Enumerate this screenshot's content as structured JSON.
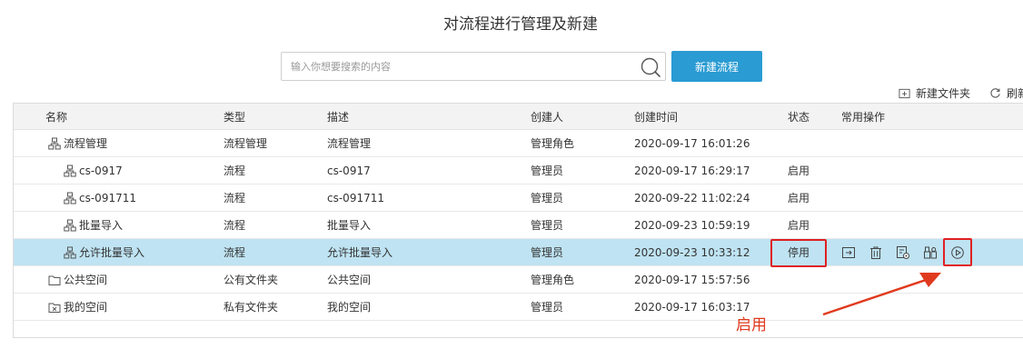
{
  "title": "对流程进行管理及新建",
  "search": {
    "placeholder": "输入你想要搜索的内容",
    "value": ""
  },
  "new_flow_button": "新建流程",
  "toolbar": {
    "new_folder": "新建文件夹",
    "refresh": "刷新"
  },
  "table": {
    "columns": [
      "名称",
      "类型",
      "描述",
      "创建人",
      "创建时间",
      "状态",
      "常用操作"
    ],
    "rows": [
      {
        "name": "流程管理",
        "icon": "flow-tree-icon",
        "type": "流程管理",
        "description": "流程管理",
        "creator": "管理角色",
        "created": "2020-09-17 16:01:26",
        "status": ""
      },
      {
        "name": "cs-0917",
        "icon": "flow-tree-icon",
        "type": "流程",
        "description": "cs-0917",
        "creator": "管理员",
        "created": "2020-09-17 16:29:17",
        "status": "启用"
      },
      {
        "name": "cs-091711",
        "icon": "flow-tree-icon",
        "type": "流程",
        "description": "cs-091711",
        "creator": "管理员",
        "created": "2020-09-22 11:02:24",
        "status": "启用"
      },
      {
        "name": "批量导入",
        "icon": "flow-tree-icon",
        "type": "流程",
        "description": "批量导入",
        "creator": "管理员",
        "created": "2020-09-23 10:59:19",
        "status": "启用"
      },
      {
        "name": "允许批量导入",
        "icon": "flow-tree-icon",
        "type": "流程",
        "description": "允许批量导入",
        "creator": "管理员",
        "created": "2020-09-23 10:33:12",
        "status": "停用",
        "selected": true
      },
      {
        "name": "公共空间",
        "icon": "folder-icon",
        "type": "公有文件夹",
        "description": "公共空间",
        "creator": "管理角色",
        "created": "2020-09-17 15:57:56",
        "status": ""
      },
      {
        "name": "我的空间",
        "icon": "private-folder-icon",
        "type": "私有文件夹",
        "description": "我的空间",
        "creator": "管理员",
        "created": "2020-09-17 16:03:17",
        "status": ""
      }
    ]
  },
  "operations": [
    "move-to-icon",
    "delete-icon",
    "settings-icon",
    "permissions-icon",
    "enable-icon"
  ],
  "annotation": {
    "label": "启用",
    "color": "#e03a1e"
  },
  "colors": {
    "accent": "#2a9bd3",
    "selected_row": "#bfe3f2",
    "highlight": "#e02020"
  }
}
